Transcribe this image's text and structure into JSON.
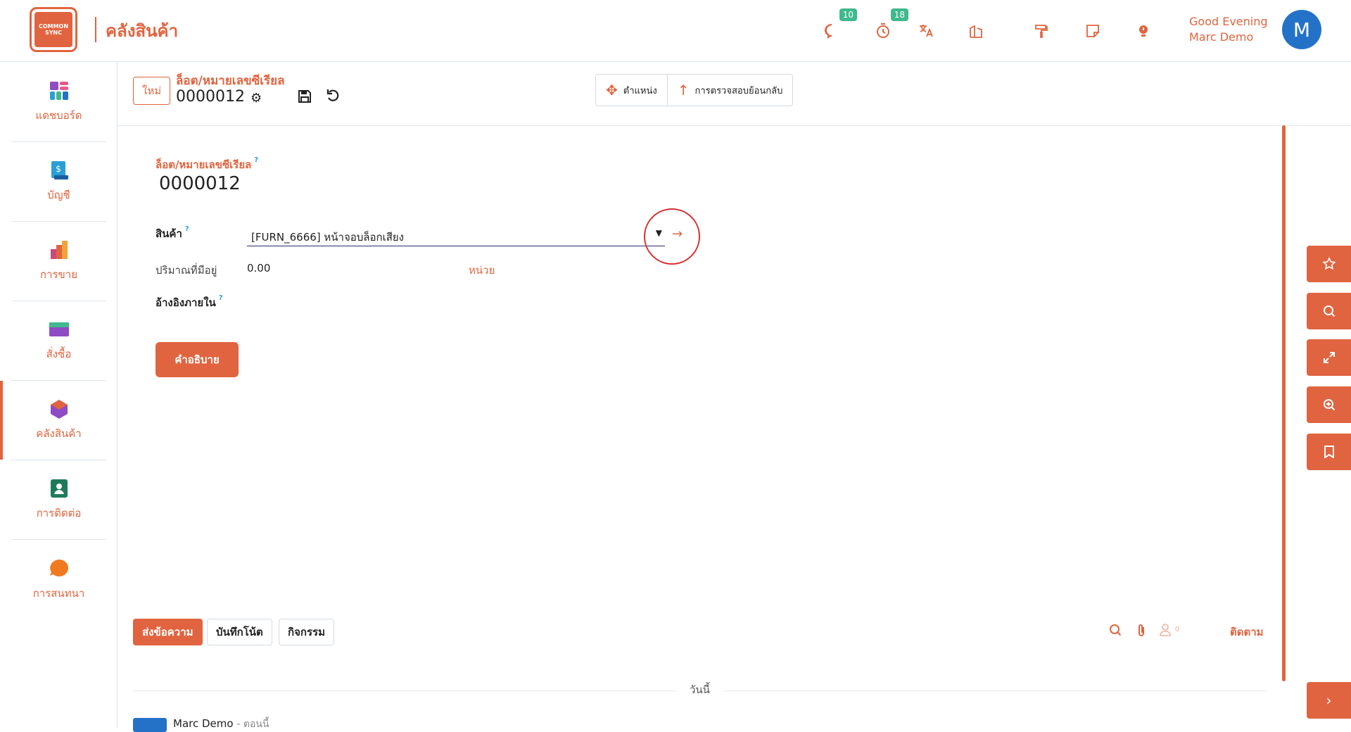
{
  "header": {
    "logo_text_1": "COMMON",
    "logo_text_2": "SYNC",
    "app_title": "คลังสินค้า",
    "greeting": "Good Evening",
    "user_name": "Marc Demo",
    "avatar_letter": "M",
    "messages_count": "10",
    "activities_count": "18"
  },
  "sidebar": {
    "items": [
      {
        "label": "แดชบอร์ด",
        "icon": "dashboard-icon"
      },
      {
        "label": "บัญชี",
        "icon": "invoice-icon"
      },
      {
        "label": "การขาย",
        "icon": "sales-chart-icon"
      },
      {
        "label": "สั่งซื้อ",
        "icon": "purchase-card-icon"
      },
      {
        "label": "คลังสินค้า",
        "icon": "inventory-box-icon",
        "active": true
      },
      {
        "label": "การติดต่อ",
        "icon": "contact-icon"
      },
      {
        "label": "การสนทนา",
        "icon": "chat-bubble-icon"
      }
    ]
  },
  "control": {
    "new_label": "ใหม่",
    "breadcrumb_title": "ล็อต/หมายเลขซีเรียล",
    "record_name": "0000012",
    "smart_location": "ตำแหน่ง",
    "smart_traceability": "การตรวจสอบย้อนกลับ"
  },
  "form": {
    "lot_label": "ล็อต/หมายเลขซีเรียล",
    "lot_value": "0000012",
    "product_label": "สินค้า",
    "product_value": "[FURN_6666] หน้าจอบล็อกเสียง",
    "qty_label": "ปริมาณที่มีอยู่",
    "qty_value": "0.00",
    "unit_label": "หน่วย",
    "ref_label": "อ้างอิงภายใน",
    "description_button": "คำอธิบาย",
    "help_mark": "?"
  },
  "chatter": {
    "send_message": "ส่งข้อความ",
    "log_note": "บันทึกโน้ต",
    "activity": "กิจกรรม",
    "followers_count": "0",
    "follow": "ติดตาม",
    "today": "วันนี้",
    "message_author": "Marc Demo",
    "message_time": "ตอนนี้"
  },
  "colors": {
    "accent": "#e0643f",
    "badge": "#3fb98d",
    "avatar": "#2472c8"
  }
}
